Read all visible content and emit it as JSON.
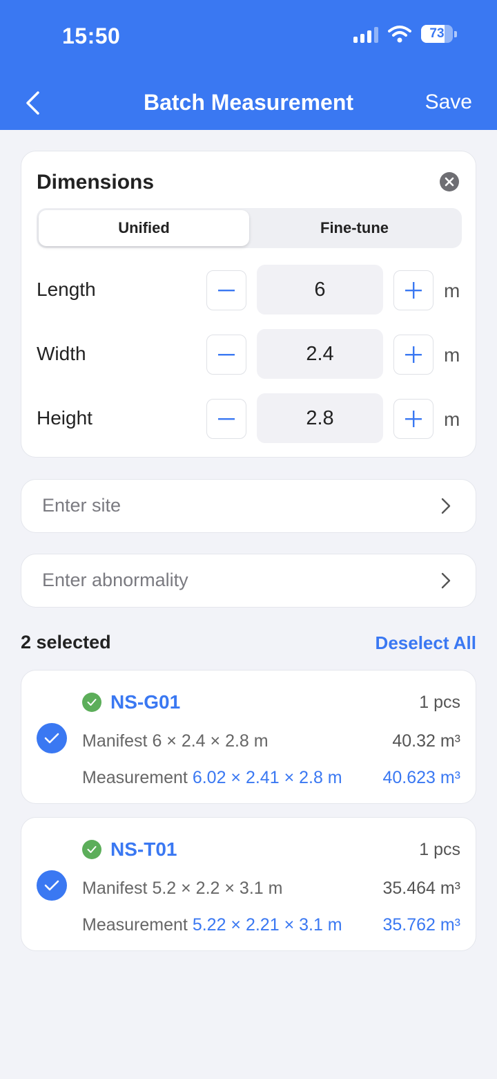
{
  "status_bar": {
    "time": "15:50",
    "battery": "73",
    "battery_level": 0.73
  },
  "nav": {
    "title": "Batch Measurement",
    "save_label": "Save"
  },
  "dimensions": {
    "title": "Dimensions",
    "tabs": [
      {
        "label": "Unified",
        "active": true
      },
      {
        "label": "Fine-tune",
        "active": false
      }
    ],
    "rows": [
      {
        "label": "Length",
        "value": "6",
        "unit": "m"
      },
      {
        "label": "Width",
        "value": "2.4",
        "unit": "m"
      },
      {
        "label": "Height",
        "value": "2.8",
        "unit": "m"
      }
    ]
  },
  "fields": {
    "site_placeholder": "Enter site",
    "abnormality_placeholder": "Enter abnormality"
  },
  "selection": {
    "count_label": "2 selected",
    "deselect_label": "Deselect All"
  },
  "items": [
    {
      "code": "NS-G01",
      "qty": "1 pcs",
      "checked": true,
      "manifest_label": "Manifest",
      "manifest_dims": "6 × 2.4 × 2.8 m",
      "manifest_volume": "40.32 m³",
      "measurement_label": "Measurement",
      "measurement_dims": "6.02 × 2.41 × 2.8 m",
      "measurement_volume": "40.623 m³"
    },
    {
      "code": "NS-T01",
      "qty": "1 pcs",
      "checked": true,
      "manifest_label": "Manifest",
      "manifest_dims": "5.2 × 2.2 × 3.1 m",
      "manifest_volume": "35.464 m³",
      "measurement_label": "Measurement",
      "measurement_dims": "5.22 × 2.21 × 3.1 m",
      "measurement_volume": "35.762 m³"
    }
  ],
  "colors": {
    "accent": "#3a78f2",
    "ok": "#5cae5a",
    "background": "#f2f3f8"
  },
  "icons": [
    "cellular-signal-icon",
    "wifi-icon",
    "battery-icon",
    "back-chevron-icon",
    "close-icon",
    "minus-icon",
    "plus-icon",
    "chevron-right-icon",
    "check-circle-icon",
    "ok-check-icon"
  ]
}
